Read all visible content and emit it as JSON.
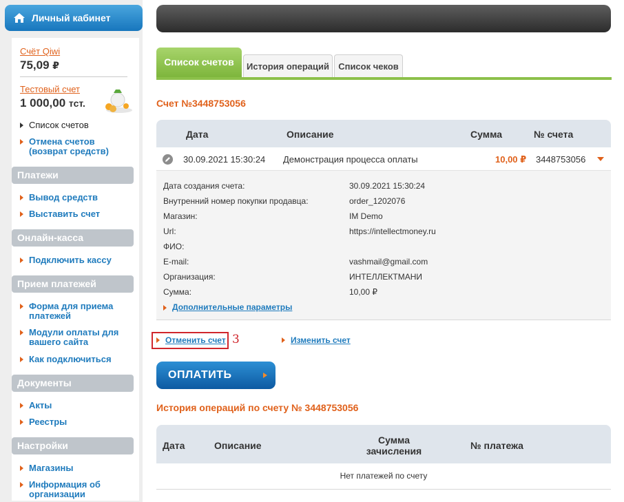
{
  "sidebar": {
    "header": "Личный кабинет",
    "accounts": [
      {
        "link": "Счёт Qiwi",
        "value": "75,09",
        "currency": "₽"
      },
      {
        "link": "Тестовый счет",
        "value": "1 000,00",
        "currency": "тст."
      }
    ],
    "current_items": [
      "Список счетов"
    ],
    "account_items": [
      "Отмена счетов (возврат средств)"
    ],
    "sections": [
      {
        "title": "Платежи",
        "items": [
          "Вывод средств",
          "Выставить счет"
        ]
      },
      {
        "title": "Онлайн-касса",
        "items": [
          "Подключить кассу"
        ]
      },
      {
        "title": "Прием платежей",
        "items": [
          "Форма для приема платежей",
          "Модули оплаты для вашего сайта",
          "Как подключиться"
        ]
      },
      {
        "title": "Документы",
        "items": [
          "Акты",
          "Реестры"
        ]
      },
      {
        "title": "Настройки",
        "items": [
          "Магазины",
          "Информация об организации"
        ]
      }
    ]
  },
  "tabs": [
    "Список счетов",
    "История операций",
    "Список чеков"
  ],
  "invoice": {
    "title": "Счет №3448753056",
    "columns": [
      "Дата",
      "Описание",
      "Сумма",
      "№ счета"
    ],
    "row": {
      "date": "30.09.2021 15:30:24",
      "description": "Демонстрация процесса оплаты",
      "amount": "10,00 ₽",
      "number": "3448753056"
    },
    "details": [
      {
        "label": "Дата создания счета:",
        "value": "30.09.2021 15:30:24"
      },
      {
        "label": "Внутренний номер покупки продавца:",
        "value": "order_1202076"
      },
      {
        "label": "Магазин:",
        "value": "IM Demo"
      },
      {
        "label": "Url:",
        "value": "https://intellectmoney.ru"
      },
      {
        "label": "ФИО:",
        "value": ""
      },
      {
        "label": "E-mail:",
        "value": "vashmail@gmail.com"
      },
      {
        "label": "Организация:",
        "value": "ИНТЕЛЛЕКТМАНИ"
      },
      {
        "label": "Сумма:",
        "value": "10,00 ₽"
      }
    ],
    "extra_params": "Дополнительные параметры"
  },
  "actions": {
    "cancel": "Отменить счет",
    "edit": "Изменить счет",
    "step": "3",
    "pay": "ОПЛАТИТЬ"
  },
  "history": {
    "title": "История операций по счету № 3448753056",
    "columns": [
      "Дата",
      "Описание",
      "Сумма зачисления",
      "№ платежа"
    ],
    "empty": "Нет платежей по счету"
  },
  "colors": {
    "accent": "#e0611b",
    "link": "#1f7bbd",
    "tab_active": "#8cc04a",
    "highlight": "#d0262c"
  }
}
